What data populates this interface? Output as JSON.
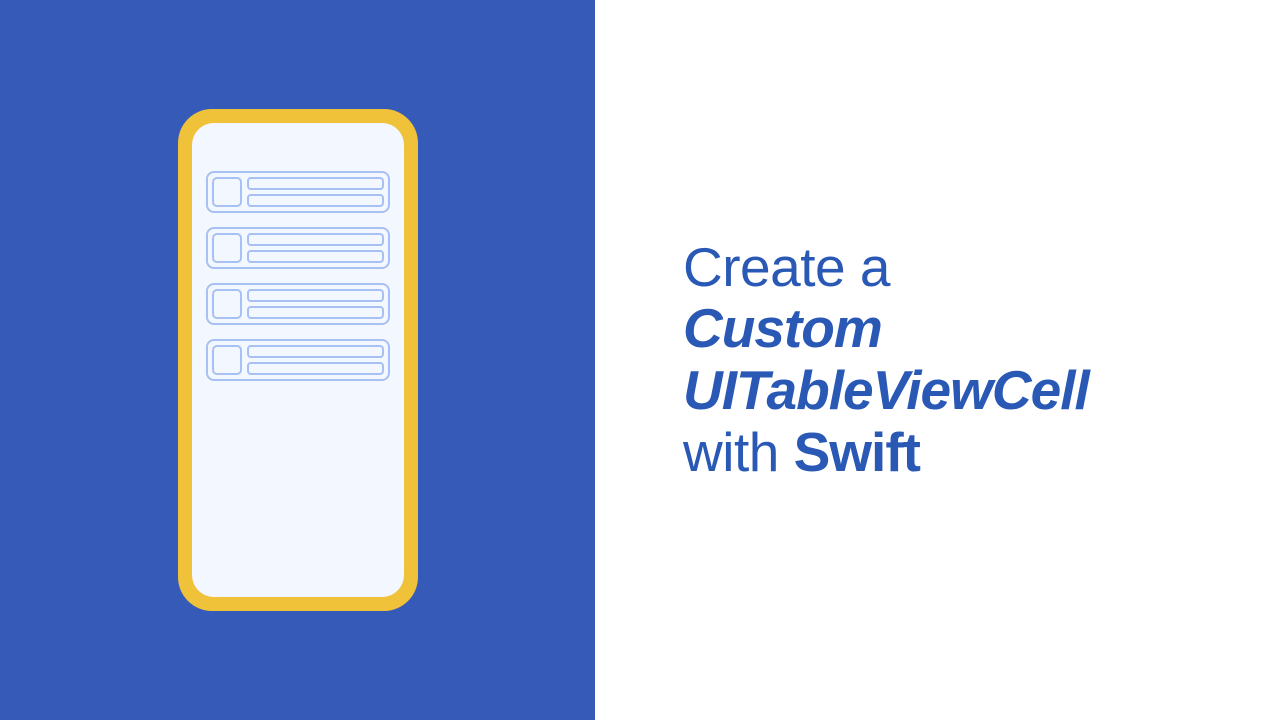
{
  "headline": {
    "l1a": "Create",
    "l1b": " a",
    "l2": "Custom",
    "l3": "UITableViewCell",
    "l4a": "with ",
    "l4b": "Swift"
  },
  "mockup": {
    "cell_count": 4
  },
  "colors": {
    "panel_blue": "#355ab8",
    "text_blue": "#2a58b5",
    "phone_gold": "#efc23a",
    "screen_bg": "#f3f7ff",
    "wire_blue": "#a8c1f4"
  }
}
